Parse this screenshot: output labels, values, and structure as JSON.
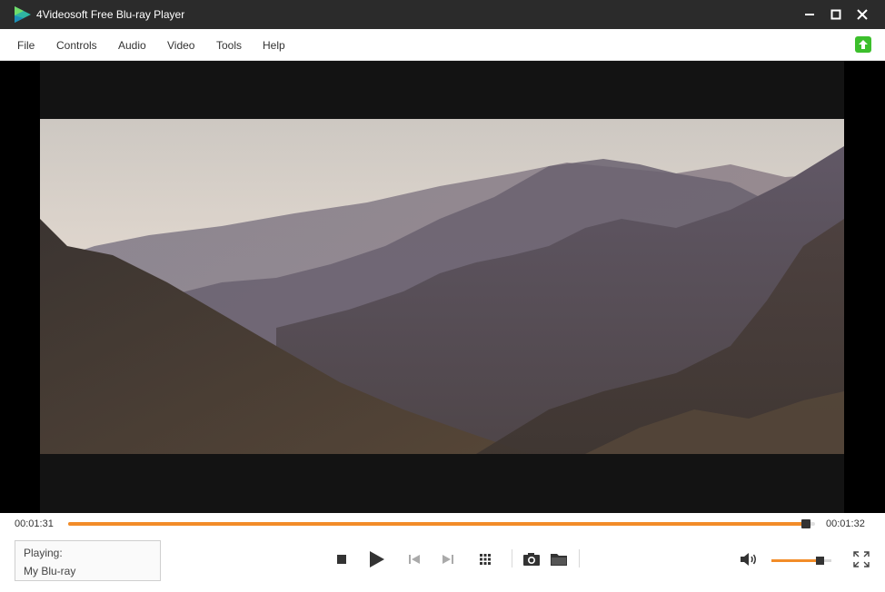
{
  "window": {
    "title": "4Videosoft Free Blu-ray Player",
    "accent": "#f28c28",
    "titlebar_color": "#2b2b2b"
  },
  "menu": {
    "items": [
      "File",
      "Controls",
      "Audio",
      "Video",
      "Tools",
      "Help"
    ],
    "update_icon": "upload-arrow-icon"
  },
  "player": {
    "elapsed": "00:01:31",
    "duration": "00:01:32",
    "progress_fraction": 0.988,
    "volume_fraction": 0.8,
    "status_label": "Playing:",
    "media_title": "My Blu-ray"
  },
  "controls": {
    "icons": [
      "stop-icon",
      "play-icon",
      "previous-icon",
      "next-icon",
      "chapter-grid-icon",
      "snapshot-camera-icon",
      "folder-icon",
      "volume-icon",
      "fullscreen-icon"
    ]
  }
}
